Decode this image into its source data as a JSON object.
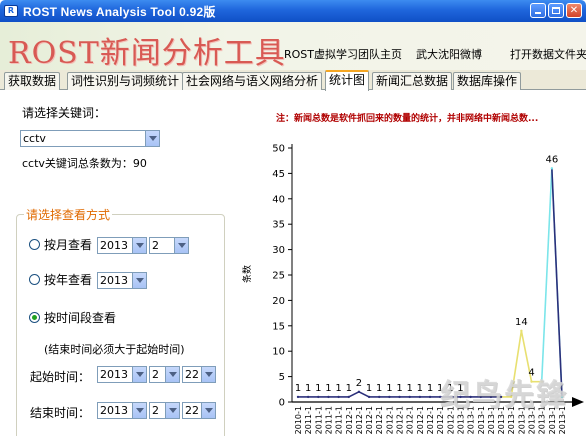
{
  "window": {
    "title": "ROST News Analysis Tool 0.92版"
  },
  "banner": {
    "logo_text": "ROST新闻分析工具",
    "links": [
      "ROST虚拟学习团队主页",
      "武大沈阳微博",
      "打开数据文件夹"
    ]
  },
  "tabs": [
    {
      "label": "获取数据",
      "active": false
    },
    {
      "label": "词性识别与词频统计",
      "active": false
    },
    {
      "label": "社会网络与语义网络分析",
      "active": false
    },
    {
      "label": "统计图",
      "active": true
    },
    {
      "label": "新闻汇总数据",
      "active": false
    },
    {
      "label": "数据库操作",
      "active": false
    }
  ],
  "keyword": {
    "prompt": "请选择关键词：",
    "selected": "cctv",
    "total_text": "cctv关键词总条数为：90"
  },
  "view_mode": {
    "group_title": "请选择查看方式",
    "by_month": {
      "label": "按月查看",
      "year": "2013",
      "month": "2",
      "checked": false
    },
    "by_year": {
      "label": "按年查看",
      "year": "2013",
      "checked": false
    },
    "by_period": {
      "label": "按时间段查看",
      "checked": true
    },
    "period_hint": "(结束时间必须大于起始时间)",
    "start": {
      "label": "起始时间：",
      "year": "2013",
      "month": "2",
      "day": "22"
    },
    "end": {
      "label": "结束时间：",
      "year": "2013",
      "month": "2",
      "day": "22"
    }
  },
  "note": "注：新闻总数是软件抓回来的数量的统计，并非网络中新闻总数...",
  "watermark": "纪鸟先锋",
  "colors": {
    "accent_orange": "#e06a00",
    "note_red": "#b00000",
    "title_blue": "#1f66dc",
    "line_navy": "#2b2f7a",
    "line_yellow": "#e8e070",
    "line_cyan": "#7be5ea"
  },
  "chart_data": {
    "type": "line",
    "ylabel": "条数",
    "ylim": [
      0,
      50
    ],
    "yticks": [
      0,
      5,
      10,
      15,
      20,
      25,
      30,
      35,
      40,
      45,
      50
    ],
    "x": [
      "2010-1",
      "2011-1",
      "2011-1",
      "2011-1",
      "2011-1",
      "2012-1",
      "2012-1",
      "2012-1",
      "2012-1",
      "2012-1",
      "2012-1",
      "2012-1",
      "2012-1",
      "2012-1",
      "2012-1",
      "2012-1",
      "2013-1",
      "2013-1",
      "2013-1",
      "2013-1",
      "2013-1",
      "2013-1",
      "2013-1",
      "2013-1",
      "2013-1",
      "2013-1",
      "2013-1"
    ],
    "values": [
      1,
      1,
      1,
      1,
      1,
      1,
      2,
      1,
      1,
      1,
      1,
      1,
      1,
      1,
      1,
      1,
      1,
      1,
      1,
      1,
      1,
      1,
      14,
      4,
      4,
      46,
      1
    ],
    "data_labels": [
      "1",
      "1",
      "1",
      "1",
      "1",
      "1",
      "2",
      "1",
      "1",
      "1",
      "1",
      "1",
      "1",
      "1",
      "1",
      "1",
      "1",
      "",
      "",
      "",
      "",
      "",
      "14",
      "4",
      "",
      "46",
      ""
    ],
    "grid": false,
    "legend": "none"
  }
}
